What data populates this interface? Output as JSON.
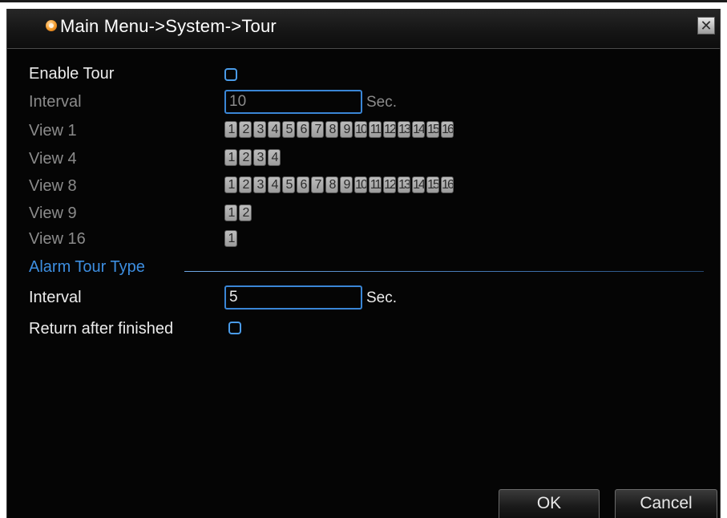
{
  "window": {
    "title": "Main Menu->System->Tour",
    "close_label": "✕"
  },
  "form": {
    "enable_tour_label": "Enable Tour",
    "enable_tour_checked": false,
    "interval_label": "Interval",
    "interval_value": "10",
    "interval_unit": "Sec.",
    "views": [
      {
        "label": "View 1",
        "channels": [
          "1",
          "2",
          "3",
          "4",
          "5",
          "6",
          "7",
          "8",
          "9",
          "10",
          "11",
          "12",
          "13",
          "14",
          "15",
          "16"
        ]
      },
      {
        "label": "View 4",
        "channels": [
          "1",
          "2",
          "3",
          "4"
        ]
      },
      {
        "label": "View 8",
        "channels": [
          "1",
          "2",
          "3",
          "4",
          "5",
          "6",
          "7",
          "8",
          "9",
          "10",
          "11",
          "12",
          "13",
          "14",
          "15",
          "16"
        ]
      },
      {
        "label": "View 9",
        "channels": [
          "1",
          "2"
        ]
      },
      {
        "label": "View 16",
        "channels": [
          "1"
        ]
      }
    ],
    "alarm_section_label": "Alarm Tour Type",
    "alarm_interval_label": "Interval",
    "alarm_interval_value": "5",
    "alarm_interval_unit": "Sec.",
    "return_after_finished_label": "Return after finished",
    "return_after_finished_checked": false
  },
  "buttons": {
    "ok_label": "OK",
    "cancel_label": "Cancel"
  },
  "colors": {
    "background": "#050505",
    "accent_blue": "#3d8ee0",
    "title_icon": "#f39a2a",
    "channel_button": "#a8a8a8"
  },
  "icons": {
    "title": "orange-dot-icon",
    "close": "close-icon"
  }
}
